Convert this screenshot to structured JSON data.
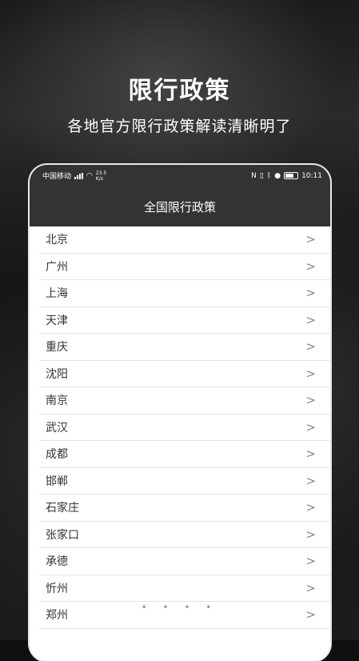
{
  "promo": {
    "title": "限行政策",
    "subtitle": "各地官方限行政策解读清晰明了"
  },
  "status_bar": {
    "carrier": "中国移动",
    "net_speed": "23.5",
    "net_unit": "K/s",
    "time": "10:11",
    "icons": [
      "nfc-icon",
      "vibrate-icon",
      "bluetooth-icon",
      "location-icon",
      "battery-icon"
    ]
  },
  "app": {
    "title": "全国限行政策"
  },
  "cities": [
    {
      "name": "北京"
    },
    {
      "name": "广州"
    },
    {
      "name": "上海"
    },
    {
      "name": "天津"
    },
    {
      "name": "重庆"
    },
    {
      "name": "沈阳"
    },
    {
      "name": "南京"
    },
    {
      "name": "武汉"
    },
    {
      "name": "成都"
    },
    {
      "name": "邯郸"
    },
    {
      "name": "石家庄"
    },
    {
      "name": "张家口"
    },
    {
      "name": "承德"
    },
    {
      "name": "忻州"
    },
    {
      "name": "郑州"
    }
  ],
  "chevron": ">",
  "pager_dots": "• • • •"
}
